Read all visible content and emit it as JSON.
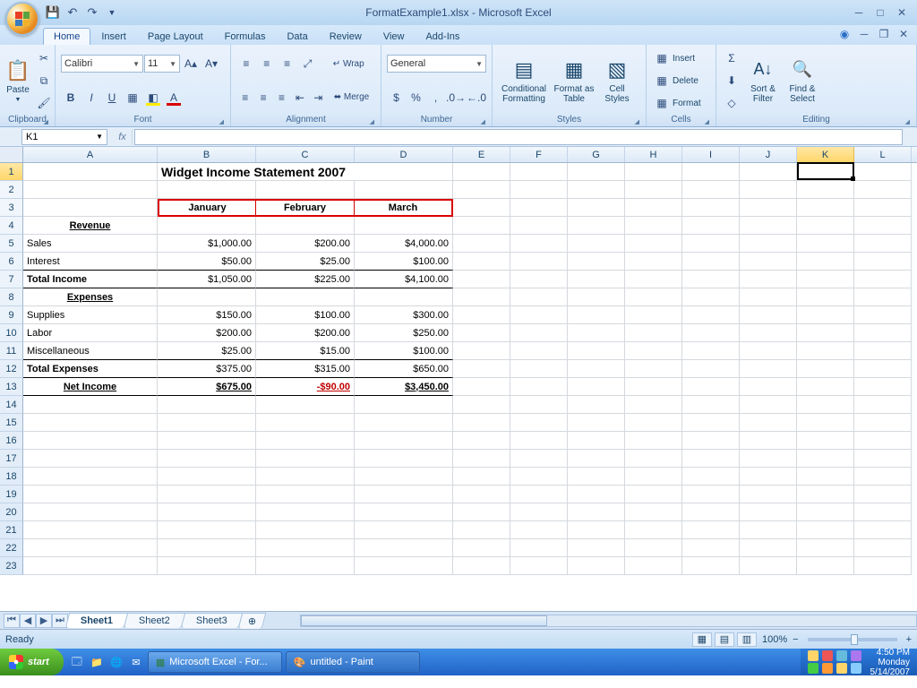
{
  "app": {
    "title": "FormatExample1.xlsx - Microsoft Excel",
    "name_box": "K1",
    "status_ready": "Ready",
    "zoom": "100%"
  },
  "tabs": {
    "home": "Home",
    "insert": "Insert",
    "page_layout": "Page Layout",
    "formulas": "Formulas",
    "data": "Data",
    "review": "Review",
    "view": "View",
    "addins": "Add-Ins"
  },
  "ribbon": {
    "clipboard": {
      "label": "Clipboard",
      "paste": "Paste"
    },
    "font": {
      "label": "Font",
      "name": "Calibri",
      "size": "11"
    },
    "alignment": {
      "label": "Alignment"
    },
    "number": {
      "label": "Number",
      "format": "General"
    },
    "styles": {
      "label": "Styles",
      "cond": "Conditional Formatting",
      "table": "Format as Table",
      "cell": "Cell Styles"
    },
    "cells": {
      "label": "Cells",
      "insert": "Insert",
      "delete": "Delete",
      "format": "Format"
    },
    "editing": {
      "label": "Editing",
      "sort": "Sort & Filter",
      "find": "Find & Select"
    }
  },
  "sheets": {
    "s1": "Sheet1",
    "s2": "Sheet2",
    "s3": "Sheet3"
  },
  "columns": [
    "A",
    "B",
    "C",
    "D",
    "E",
    "F",
    "G",
    "H",
    "I",
    "J",
    "K",
    "L"
  ],
  "doc": {
    "title": "Widget Income Statement 2007",
    "months": {
      "jan": "January",
      "feb": "February",
      "mar": "March"
    },
    "revenue_label": "Revenue",
    "sales_label": "Sales",
    "interest_label": "Interest",
    "total_income_label": "Total Income",
    "expenses_label": "Expenses",
    "supplies_label": "Supplies",
    "labor_label": "Labor",
    "misc_label": "Miscellaneous",
    "total_expenses_label": "Total Expenses",
    "net_income_label": "Net Income",
    "sales": {
      "jan": "$1,000.00",
      "feb": "$200.00",
      "mar": "$4,000.00"
    },
    "interest": {
      "jan": "$50.00",
      "feb": "$25.00",
      "mar": "$100.00"
    },
    "tincome": {
      "jan": "$1,050.00",
      "feb": "$225.00",
      "mar": "$4,100.00"
    },
    "supplies": {
      "jan": "$150.00",
      "feb": "$100.00",
      "mar": "$300.00"
    },
    "labor": {
      "jan": "$200.00",
      "feb": "$200.00",
      "mar": "$250.00"
    },
    "misc": {
      "jan": "$25.00",
      "feb": "$15.00",
      "mar": "$100.00"
    },
    "texp": {
      "jan": "$375.00",
      "feb": "$315.00",
      "mar": "$650.00"
    },
    "net": {
      "jan": "$675.00",
      "feb": "-$90.00",
      "mar": "$3,450.00"
    }
  },
  "taskbar": {
    "start": "start",
    "app1": "Microsoft Excel - For...",
    "app2": "untitled - Paint",
    "time": "4:50 PM",
    "day": "Monday",
    "date": "5/14/2007"
  }
}
